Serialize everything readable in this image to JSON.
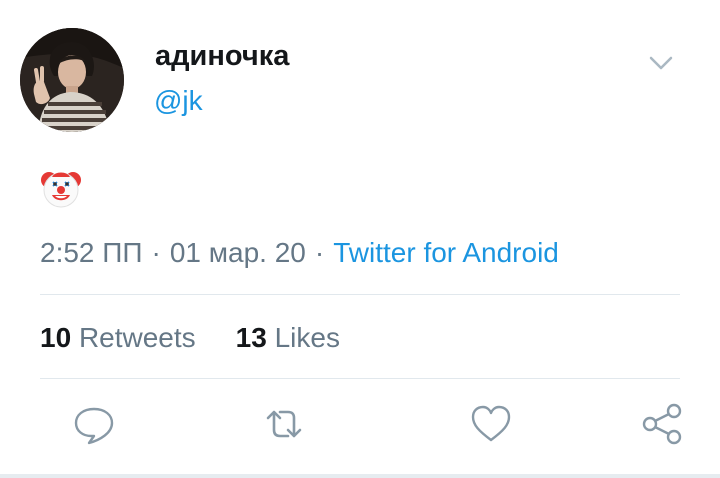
{
  "tweet": {
    "display_name": "адиночка",
    "handle": "@jk",
    "emoji": "clown-face",
    "time": "2:52 ПП",
    "separator": "·",
    "date": "01 мар. 20",
    "source": "Twitter for Android"
  },
  "stats": {
    "retweets_count": "10",
    "retweets_label": "Retweets",
    "likes_count": "13",
    "likes_label": "Likes"
  },
  "actions": [
    {
      "icon": "reply-icon"
    },
    {
      "icon": "retweet-icon"
    },
    {
      "icon": "like-icon"
    },
    {
      "icon": "share-icon"
    }
  ],
  "colors": {
    "link": "#1b95e0",
    "secondary_text": "#657786",
    "primary_text": "#14171a",
    "divider": "#e1e8ed"
  }
}
